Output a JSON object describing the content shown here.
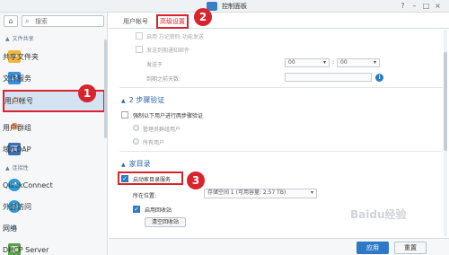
{
  "window": {
    "title": "控制面板",
    "controls": [
      "?",
      "–",
      "□",
      "×"
    ]
  },
  "sidebar": {
    "search_placeholder": "搜索",
    "sections": [
      {
        "label": "文件共享"
      },
      {
        "label": "连接性"
      }
    ],
    "items": [
      {
        "label": "共享文件夹",
        "icon": "shared-folder-icon",
        "color": "#e9a82b"
      },
      {
        "label": "文件服务",
        "icon": "file-services-icon",
        "color": "#3b8fd9"
      },
      {
        "label": "用户帐号",
        "icon": "user-icon",
        "color": "#e98b5a"
      },
      {
        "label": "用户群组",
        "icon": "user-group-icon",
        "color": "#e98b5a"
      },
      {
        "label": "域/LDAP",
        "icon": "domain-ldap-icon",
        "color": "#3b6fb3"
      },
      {
        "label": "QuickConnect",
        "icon": "quickconnect-icon",
        "color": "#2c9ad6"
      },
      {
        "label": "外部访问",
        "icon": "external-access-icon",
        "color": "#2c9ad6"
      },
      {
        "label": "网络",
        "icon": "network-icon",
        "color": "#3b8fd9"
      },
      {
        "label": "DHCP Server",
        "icon": "dhcp-server-icon",
        "color": "#5aa04a"
      }
    ]
  },
  "tabs": [
    {
      "label": "用户帐号"
    },
    {
      "label": "高级设置"
    }
  ],
  "badges": [
    "1",
    "2",
    "3"
  ],
  "password": {
    "partial_text": "启用 忘记密码 功能发送",
    "send_email_label": "发送到期通知邮件",
    "send_at_label": "发送于",
    "hour_value": "00",
    "minute_value": "00",
    "days_before_label": "到期之前天数:"
  },
  "two_step": {
    "title": "2 步骤验证",
    "enforce_label": "强制以下用户进行两步骤验证",
    "option_admins": "管理员群组用户",
    "option_all": "所有用户"
  },
  "home": {
    "title": "家目录",
    "enable_label": "启动家目录服务",
    "location_label": "所在位置:",
    "location_value": "存储空间 1 (可用容量:  2.57 TB)",
    "recycle_label": "启用回收站",
    "empty_recycle_button": "清空回收站"
  },
  "footer": {
    "apply": "应用",
    "reset": "重置"
  },
  "watermark": "Baidu经验",
  "colors": {
    "accent": "#2c7ac6",
    "highlight": "#d9232d"
  }
}
